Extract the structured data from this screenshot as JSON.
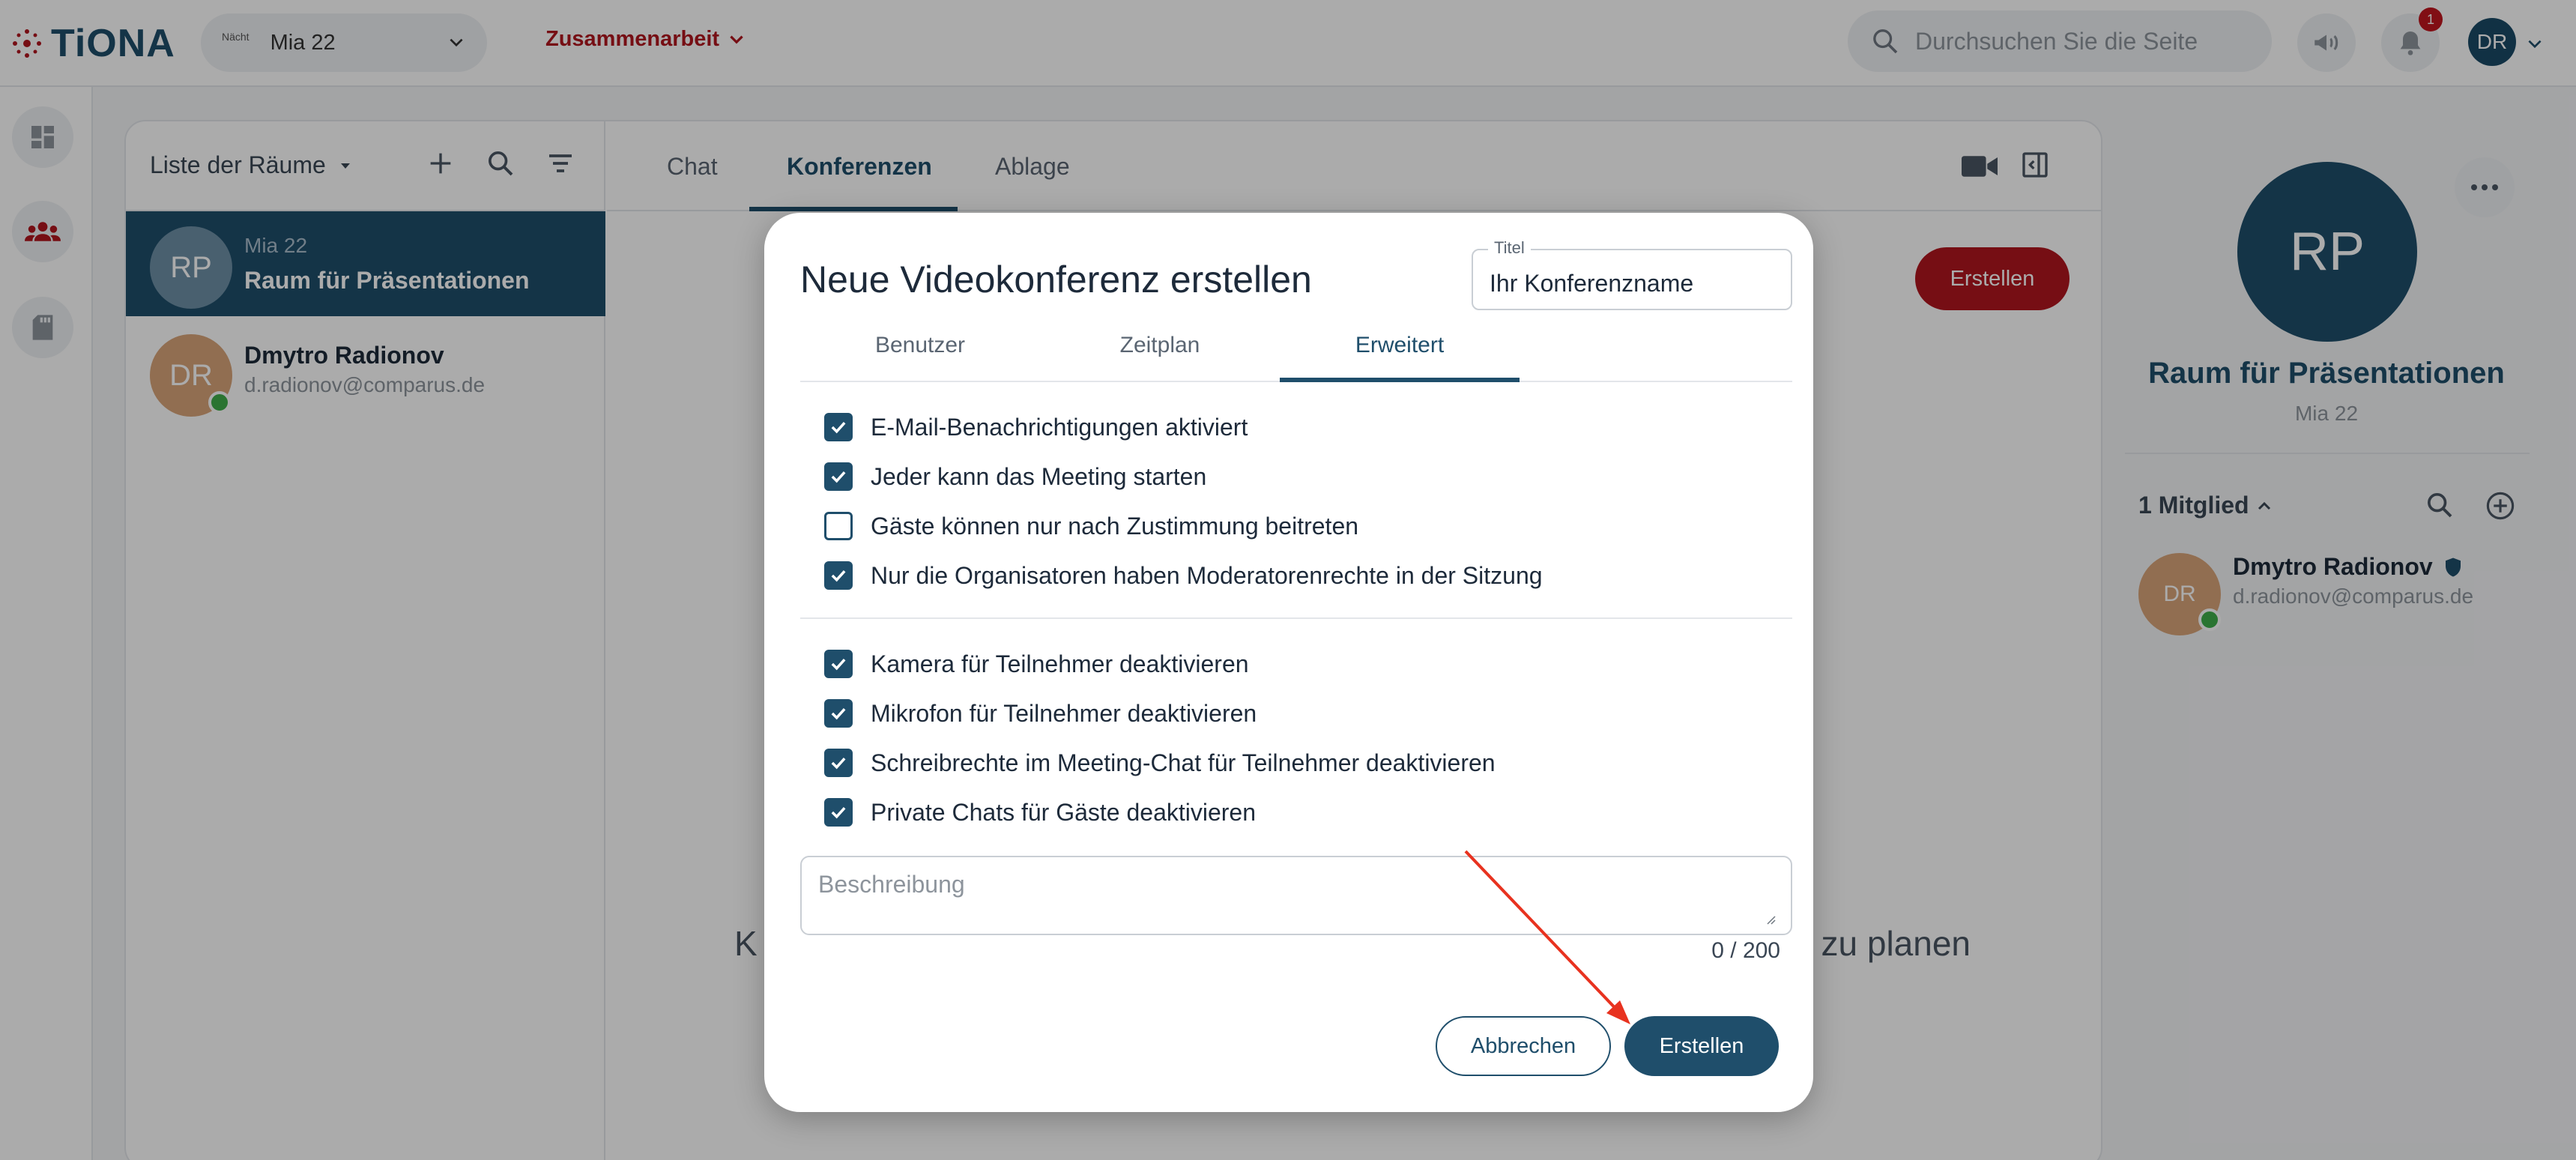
{
  "app": {
    "logo_text": "TiONA"
  },
  "topbar": {
    "workspace_badge": "Nächt",
    "workspace_label": "Mia 22",
    "nav_label": "Zusammenarbeit",
    "search_placeholder": "Durchsuchen Sie die Seite",
    "notification_count": "1",
    "user_initials": "DR"
  },
  "rooms": {
    "title": "Liste der Räume",
    "items": [
      {
        "initials": "RP",
        "subtitle": "Mia 22",
        "name": "Raum für Präsentationen",
        "active": true
      },
      {
        "initials": "DR",
        "name": "Dmytro Radionov",
        "subtitle": "d.radionov@comparus.de",
        "online": true
      }
    ]
  },
  "conference": {
    "tabs": [
      {
        "label": "Chat"
      },
      {
        "label": "Konferenzen",
        "active": true
      },
      {
        "label": "Ablage"
      }
    ],
    "create_label": "Erstellen",
    "empty_left": "K",
    "empty_right": "zu planen"
  },
  "room_panel": {
    "initials": "RP",
    "title": "Raum für Präsentationen",
    "subtitle": "Mia 22",
    "members_label": "1 Mitglied",
    "member": {
      "initials": "DR",
      "name": "Dmytro Radionov",
      "email": "d.radionov@comparus.de"
    }
  },
  "dialog": {
    "title": "Neue Videokonferenz erstellen",
    "title_field_label": "Titel",
    "title_field_placeholder": "Ihr Konferenzname",
    "tabs": [
      {
        "label": "Benutzer"
      },
      {
        "label": "Zeitplan"
      },
      {
        "label": "Erweitert",
        "active": true
      }
    ],
    "options_group1": [
      {
        "label": "E-Mail-Benachrichtigungen aktiviert",
        "checked": true
      },
      {
        "label": "Jeder kann das Meeting starten",
        "checked": true
      },
      {
        "label": "Gäste können nur nach Zustimmung beitreten",
        "checked": false
      },
      {
        "label": "Nur die Organisatoren haben Moderatorenrechte in der Sitzung",
        "checked": true
      }
    ],
    "options_group2": [
      {
        "label": "Kamera für Teilnehmer deaktivieren",
        "checked": true
      },
      {
        "label": "Mikrofon für Teilnehmer deaktivieren",
        "checked": true
      },
      {
        "label": "Schreibrechte im Meeting-Chat für Teilnehmer deaktivieren",
        "checked": true
      },
      {
        "label": "Private Chats für Gäste deaktivieren",
        "checked": true
      }
    ],
    "description_placeholder": "Beschreibung",
    "counter": "0 / 200",
    "cancel_label": "Abbrechen",
    "create_label": "Erstellen"
  },
  "colors": {
    "primary": "#1f4e6b",
    "accent_red": "#b0161f",
    "annotation_arrow": "#e8321f",
    "online": "#3fae49"
  }
}
